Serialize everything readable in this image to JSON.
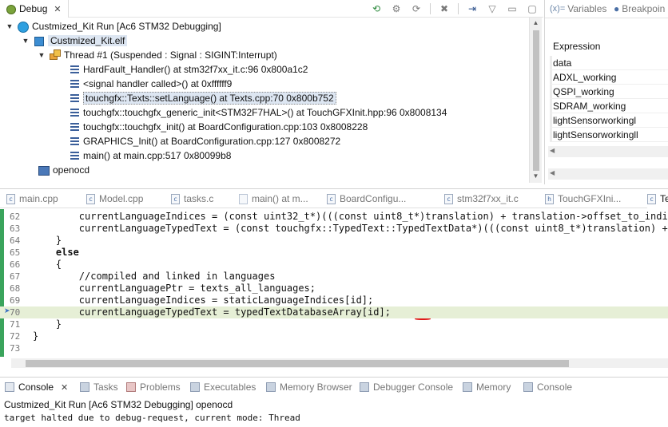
{
  "debug": {
    "tab_label": "Debug",
    "tree": [
      {
        "label": "Custmized_Kit Run [Ac6 STM32 Debugging]",
        "icon": "launch-icon"
      },
      {
        "label": "Custmized_Kit.elf",
        "icon": "elf-icon"
      },
      {
        "label": "Thread #1 (Suspended : Signal : SIGINT:Interrupt)",
        "icon": "thread-icon"
      },
      {
        "label": "HardFault_Handler() at stm32f7xx_it.c:96 0x800a1c2",
        "icon": "stack-frame-icon"
      },
      {
        "label": "<signal handler called>() at 0xffffff9",
        "icon": "stack-frame-icon"
      },
      {
        "label": "touchgfx::Texts::setLanguage() at Texts.cpp:70 0x800b752",
        "icon": "stack-frame-icon"
      },
      {
        "label": "touchgfx::touchgfx_generic_init<STM32F7HAL>() at TouchGFXInit.hpp:96 0x8008134",
        "icon": "stack-frame-icon"
      },
      {
        "label": "touchgfx::touchgfx_init() at BoardConfiguration.cpp:103 0x8008228",
        "icon": "stack-frame-icon"
      },
      {
        "label": "GRAPHICS_Init() at BoardConfiguration.cpp:127 0x8008272",
        "icon": "stack-frame-icon"
      },
      {
        "label": "main() at main.cpp:517 0x80099b8",
        "icon": "stack-frame-icon"
      },
      {
        "label": "openocd",
        "icon": "process-icon"
      }
    ]
  },
  "variables": {
    "tab_variables": "Variables",
    "tab_breakpoints": "Breakpoin",
    "expression_header": "Expression",
    "expressions": [
      "data",
      "ADXL_working",
      "QSPI_working",
      "SDRAM_working",
      "lightSensorworkingl",
      "lightSensorworkingll"
    ]
  },
  "editor": {
    "tabs": [
      "main.cpp",
      "Model.cpp",
      "tasks.c",
      "main() at m...",
      "BoardConfigu...",
      "stm32f7xx_it.c",
      "TouchGFXIni...",
      "Te"
    ],
    "tab_icons": [
      "c",
      "c",
      "c",
      "",
      "c",
      "c",
      "h",
      "c"
    ],
    "lines": [
      {
        "n": "62",
        "t": "        currentLanguageIndices = (const uint32_t*)(((const uint8_t*)translation) + translation->offset_to_indi"
      },
      {
        "n": "63",
        "t": "        currentLanguageTypedText = (const touchgfx::TypedText::TypedTextData*)(((const uint8_t*)translation) +"
      },
      {
        "n": "64",
        "t": "    }"
      },
      {
        "n": "65",
        "t": "    else"
      },
      {
        "n": "66",
        "t": "    {"
      },
      {
        "n": "67",
        "t": "        //compiled and linked in languages"
      },
      {
        "n": "68",
        "t": "        currentLanguagePtr = texts_all_languages;"
      },
      {
        "n": "69",
        "t": "        currentLanguageIndices = staticLanguageIndices[id];"
      },
      {
        "n": "70",
        "t": "        currentLanguageTypedText = typedTextDatabaseArray[id];"
      },
      {
        "n": "71",
        "t": "    }"
      },
      {
        "n": "72",
        "t": "}"
      },
      {
        "n": "73",
        "t": ""
      }
    ]
  },
  "console": {
    "tabs": [
      "Console",
      "Tasks",
      "Problems",
      "Executables",
      "Memory Browser",
      "Debugger Console",
      "Memory",
      "Console"
    ],
    "title": "Custmized_Kit Run [Ac6 STM32 Debugging] openocd",
    "output": "target halted due to debug-request, current mode: Thread"
  }
}
